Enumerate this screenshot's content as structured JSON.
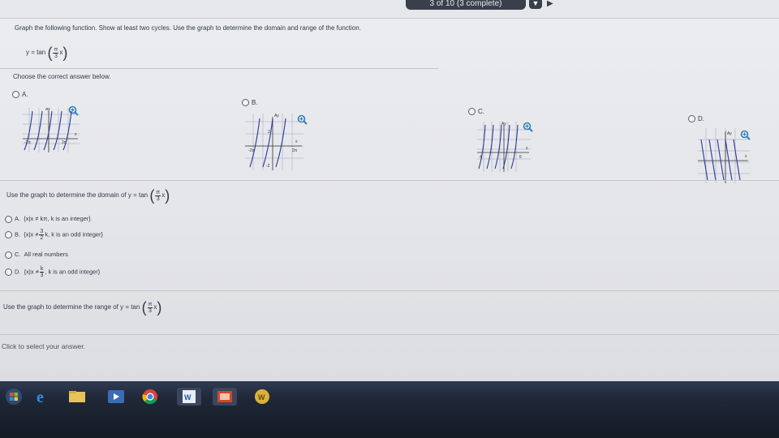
{
  "progress": {
    "text": "3 of 10 (3 complete)",
    "next_icon": "triangle-right"
  },
  "question": {
    "instruction": "Graph the following function. Show at least two cycles. Use the graph to determine the domain and range of the function.",
    "function_prefix": "y = tan",
    "frac_num": "π",
    "frac_den": "3",
    "frac_var": "x"
  },
  "choose_text": "Choose the correct answer below.",
  "graph_options": [
    {
      "label": "A.",
      "axis_y": "Ay",
      "x_neg": "-2π",
      "x_pos": "2π",
      "x_axis": "x"
    },
    {
      "label": "B.",
      "axis_y": "Ay",
      "x_neg": "-2π",
      "x_pos": "2π",
      "y_top": "2",
      "y_bot": "-2",
      "x_axis": "x"
    },
    {
      "label": "C.",
      "axis_y": "Ay",
      "x_neg": "-6",
      "x_pos": "6",
      "x_axis": "x"
    },
    {
      "label": "D.",
      "axis_y": "Ay",
      "x_axis": "x"
    }
  ],
  "domain_question": {
    "prefix": "Use the graph to determine the domain of y = tan",
    "frac_num": "π",
    "frac_den": "3",
    "frac_var": "x"
  },
  "domain_options": [
    {
      "label": "A.",
      "text_a": "{x|x ≠ kπ, k is an integer}"
    },
    {
      "label": "B.",
      "text_a": "{x|x ≠",
      "frac_num": "3",
      "frac_den": "2",
      "text_b": "k, k is an odd integer}"
    },
    {
      "label": "C.",
      "text_a": "All real numbers"
    },
    {
      "label": "D.",
      "text_a": "{x|x ≠",
      "frac_num": "k",
      "frac_den": "3",
      "text_b": ", k is an odd integer}"
    }
  ],
  "range_question": {
    "prefix": "Use the graph to determine the range of y = tan",
    "frac_num": "π",
    "frac_den": "3",
    "frac_var": "x"
  },
  "click_hint": "Click to select your answer.",
  "taskbar": {
    "items": [
      "windows-start-icon",
      "internet-explorer-icon",
      "file-explorer-icon",
      "media-player-icon",
      "chrome-icon",
      "word-icon",
      "powerpoint-icon",
      "app-icon"
    ]
  },
  "colors": {
    "accent": "#2e7fb8",
    "curve": "#2a3a9a",
    "grid": "#9aa3c8"
  }
}
